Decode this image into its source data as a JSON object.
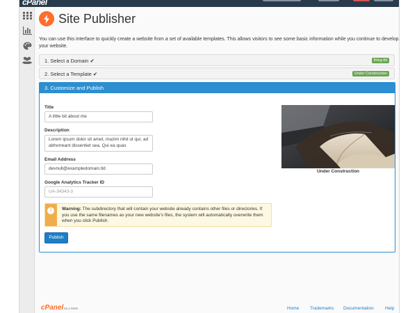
{
  "app": {
    "logo": "cPanel"
  },
  "page": {
    "title": "Site Publisher",
    "intro": "You can use this interface to quickly create a website from a set of available templates. This allows visitors to see some basic information while you continue to develop your website."
  },
  "steps": [
    {
      "label": "1. Select a Domain",
      "badge": "thing.tld"
    },
    {
      "label": "2. Select a Template",
      "badge": "Under Construction"
    }
  ],
  "panel": {
    "header": "3. Customize and Publish",
    "fields": {
      "title": {
        "label": "Title",
        "value": "A little bit about me"
      },
      "description": {
        "label": "Description",
        "value": "Lorem ipsum dolor sit amet, mazim nihil ut qui, ad abhorreant dissentiet sea. Qui ea quas"
      },
      "email": {
        "label": "Email Address",
        "value": "devnull@exampledomain.tld"
      },
      "ga": {
        "label": "Google Analytics Tracker ID",
        "placeholder": "UA-34343-3"
      }
    },
    "warning": {
      "title": "Warning:",
      "text": "The subdirectory that will contain your website already contains other files or directories. If you use the same filenames as your new website's files, the system will automatically overwrite them when you click Publish."
    },
    "publish_label": "Publish",
    "preview_caption": "Under Construction"
  },
  "footer": {
    "logo": "cPanel",
    "version": "55.0.9999",
    "links": [
      "Home",
      "Trademarks",
      "Documentation",
      "Help"
    ]
  },
  "colors": {
    "accent": "#2d8ed0",
    "brand": "#ff6c2c",
    "badge": "#6ca553",
    "warning": "#f0ad4e"
  },
  "icons": [
    "grid-icon",
    "bar-chart-icon",
    "palette-icon",
    "users-icon",
    "lightning-icon",
    "check-icon",
    "exclamation-icon"
  ]
}
